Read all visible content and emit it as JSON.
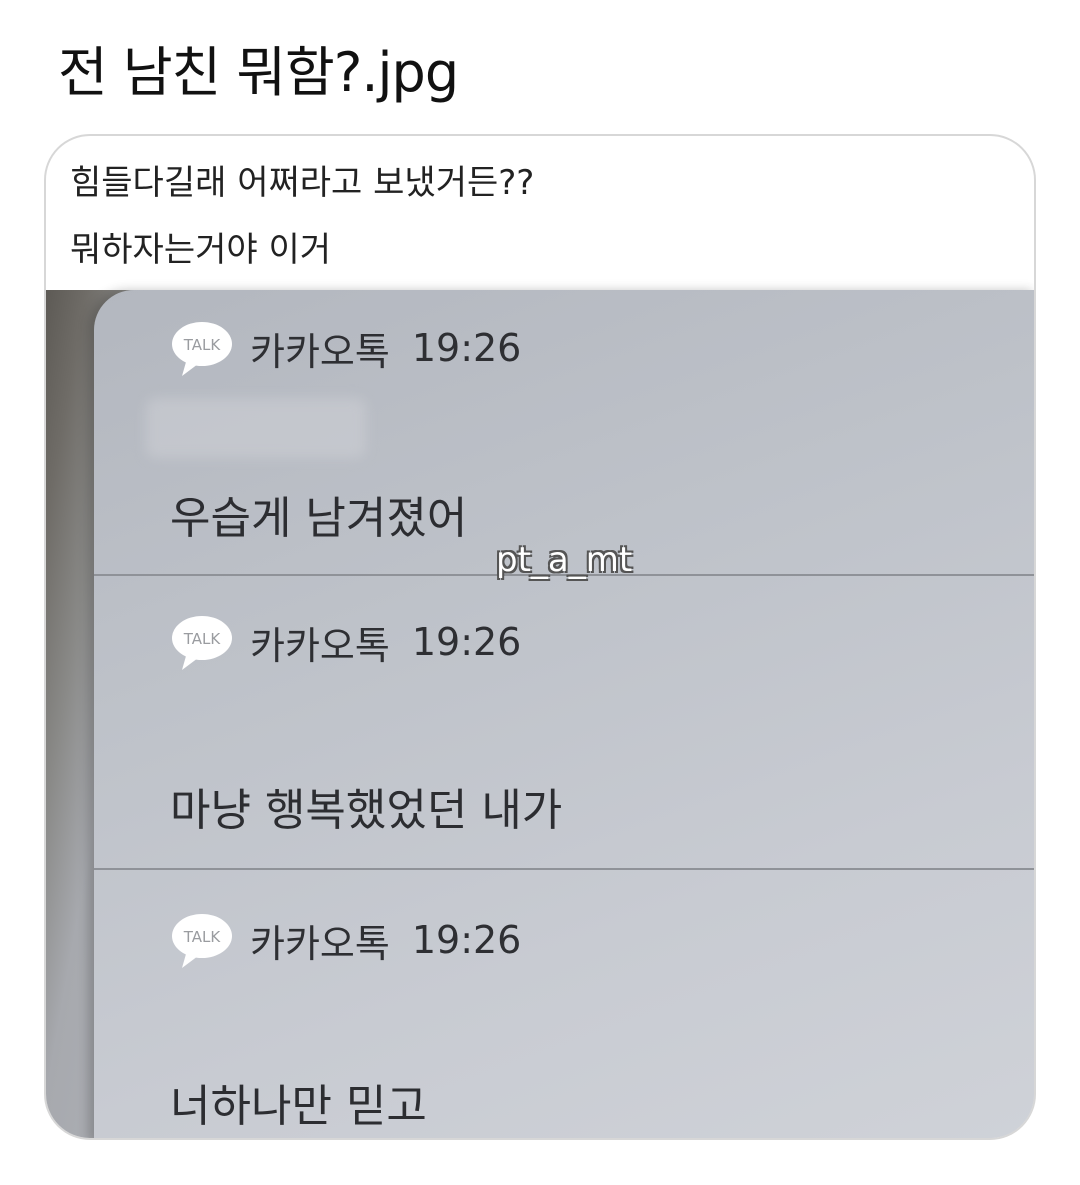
{
  "title": "전 남친 뭐함?.jpg",
  "post": {
    "line1": "힘들다길래 어쩌라고 보냈거든??",
    "line2": "뭐하자는거야 이거"
  },
  "notifications": [
    {
      "app": "카카오톡",
      "time": "19:26",
      "message": "우습게 남겨졌어"
    },
    {
      "app": "카카오톡",
      "time": "19:26",
      "message": "마냥 행복했었던 내가"
    },
    {
      "app": "카카오톡",
      "time": "19:26",
      "message": "너하나만 믿고"
    }
  ],
  "icon": {
    "name": "kakaotalk-icon",
    "label": "TALK"
  },
  "watermark": "pt_a_mt"
}
